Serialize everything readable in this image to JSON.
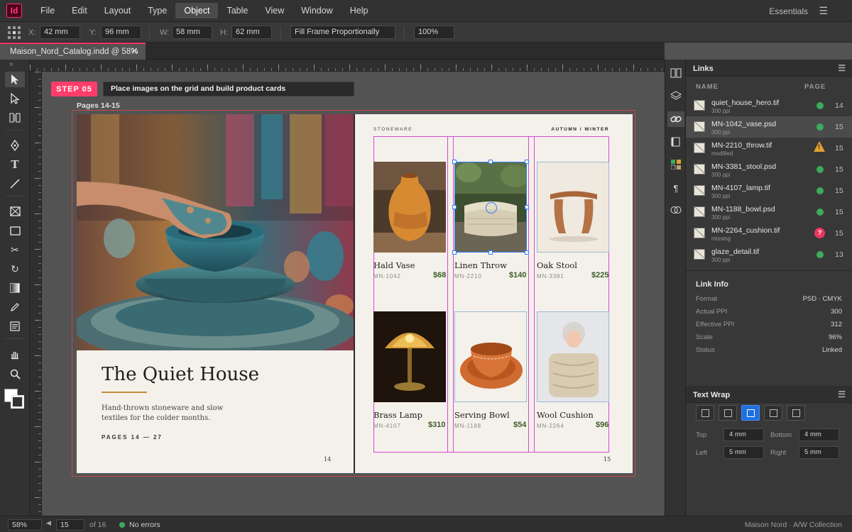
{
  "app": {
    "logo": "Id",
    "workspace": "Essentials"
  },
  "menu": [
    "File",
    "Edit",
    "Layout",
    "Type",
    "Object",
    "Table",
    "View",
    "Window",
    "Help"
  ],
  "menu_active": "Object",
  "control_bar": {
    "x_label": "X:",
    "x": "42 mm",
    "y_label": "Y:",
    "y": "96 mm",
    "w_label": "W:",
    "w": "58 mm",
    "h_label": "H:",
    "h": "62 mm",
    "fitting": "Fill Frame Proportionally",
    "scale": "100%"
  },
  "doc_tab": {
    "title": "Maison_Nord_Catalog.indd @ 58%",
    "close": "✕"
  },
  "canvas": {
    "step_badge": "STEP 05",
    "step_instruction": "Place images on the grid and build product cards",
    "pages_label": "Pages 14-15"
  },
  "spread": {
    "left": {
      "title": "The Quiet House",
      "subtitle": "Hand-thrown stoneware and slow textiles for the colder months.",
      "pages": "PAGES 14 — 27",
      "folio": "14"
    },
    "right": {
      "section": "STONEWARE",
      "season": "AUTUMN / WINTER",
      "folio": "15",
      "cards": [
        {
          "name": "Hald Vase",
          "sku": "MN-1042",
          "price": "$68"
        },
        {
          "name": "Linen Throw",
          "sku": "MN-2210",
          "price": "$140"
        },
        {
          "name": "Oak Stool",
          "sku": "MN-3381",
          "price": "$225"
        },
        {
          "name": "Brass Lamp",
          "sku": "MN-4107",
          "price": "$310"
        },
        {
          "name": "Serving Bowl",
          "sku": "MN-1188",
          "price": "$54"
        },
        {
          "name": "Wool Cushion",
          "sku": "MN-2264",
          "price": "$96"
        }
      ]
    }
  },
  "links_panel": {
    "title": "Links",
    "col_name": "NAME",
    "col_page": "PAGE",
    "items": [
      {
        "name": "quiet_house_hero.tif",
        "sub": "300 ppi",
        "status": "ok",
        "page": "14"
      },
      {
        "name": "MN-1042_vase.psd",
        "sub": "300 ppi",
        "status": "ok",
        "page": "15"
      },
      {
        "name": "MN-2210_throw.tif",
        "sub": "modified",
        "status": "modified",
        "page": "15"
      },
      {
        "name": "MN-3381_stool.psd",
        "sub": "300 ppi",
        "status": "ok",
        "page": "15"
      },
      {
        "name": "MN-4107_lamp.tif",
        "sub": "300 ppi",
        "status": "ok",
        "page": "15"
      },
      {
        "name": "MN-1188_bowl.psd",
        "sub": "300 ppi",
        "status": "ok",
        "page": "15"
      },
      {
        "name": "MN-2264_cushion.tif",
        "sub": "missing",
        "status": "missing",
        "page": "15"
      },
      {
        "name": "glaze_detail.tif",
        "sub": "300 ppi",
        "status": "ok",
        "page": "13"
      }
    ],
    "selected_index": 1,
    "missing_glyph": "?",
    "warn_glyph": "!"
  },
  "link_info": {
    "title": "Link Info",
    "rows": [
      {
        "label": "Format",
        "value": "PSD · CMYK"
      },
      {
        "label": "Actual PPI",
        "value": "300"
      },
      {
        "label": "Effective PPI",
        "value": "312"
      },
      {
        "label": "Scale",
        "value": "96%"
      },
      {
        "label": "Status",
        "value": "Linked"
      }
    ]
  },
  "text_wrap": {
    "title": "Text Wrap",
    "active_mode": 2,
    "top_label": "Top",
    "top": "4 mm",
    "bottom_label": "Bottom",
    "bottom": "4 mm",
    "left_label": "Left",
    "left": "5 mm",
    "right_label": "Right",
    "right": "5 mm"
  },
  "status_bar": {
    "zoom": "58%",
    "page": "15",
    "of_pages": "of 16",
    "preflight": "No errors",
    "right_text": "Maison Nord · A/W Collection"
  },
  "colors": {
    "accent": "#ff3366",
    "selection": "#2f7bff",
    "ok": "#3daa5c",
    "warn": "#e0a030",
    "missing": "#e8365e",
    "price": "#3e5d2b"
  },
  "icons": [
    "selection-tool-icon",
    "direct-selection-tool-icon",
    "gap-tool-icon",
    "pen-tool-icon",
    "type-tool-icon",
    "line-tool-icon",
    "rectangle-frame-tool-icon",
    "rectangle-tool-icon",
    "scissors-tool-icon",
    "rotate-tool-icon",
    "gradient-tool-icon",
    "pencil-tool-icon",
    "note-tool-icon",
    "hand-tool-icon",
    "zoom-tool-icon",
    "fill-stroke-swatch-icon"
  ]
}
